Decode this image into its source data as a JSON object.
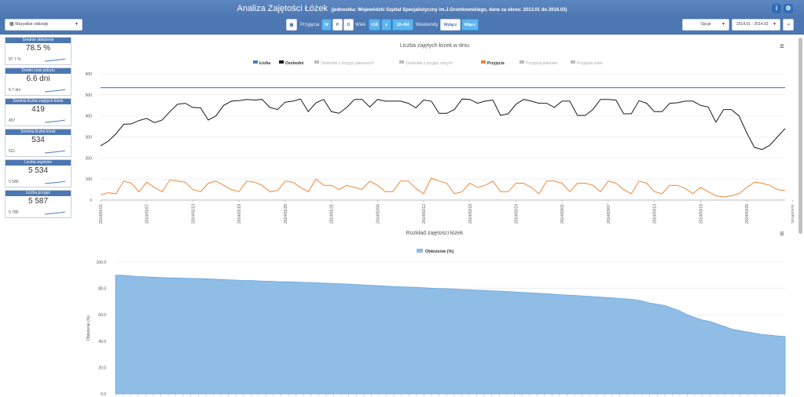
{
  "header": {
    "title": "Analiza Zajętości Łóżek",
    "subtitle": "(jednostka: Wojewódzki Szpital Specjalistyczny im.J.Gromkowskiego, dane za okres: 2013.01 do 2016.03)",
    "info_icon": "info-icon",
    "gear_icon": "gear-icon"
  },
  "toolbar": {
    "unit_select": "Wszystkie oddziały",
    "przyjecia_label": "Przyjęcia",
    "przyjecia_buttons": [
      "W",
      "P",
      "D"
    ],
    "wiek_label": "Wiek",
    "wiek_buttons": [
      "<18",
      "≥",
      "18-<64"
    ],
    "weekendy_label": "Weekendy",
    "weekendy_buttons": [
      "Wyłącz",
      "Włącz"
    ],
    "opcje": "Opcje",
    "date_range": "2014.01 - 2014.03"
  },
  "stats": [
    {
      "title": "Średnie obłożenie",
      "value": "78.5 %",
      "sub": "87.7 %"
    },
    {
      "title": "Średni czas pobytu",
      "value": "6.6 dni",
      "sub": "6.7 dni"
    },
    {
      "title": "Średnia liczba zajętych łóżek",
      "value": "419",
      "sub": "457"
    },
    {
      "title": "Średnia liczba łóżek",
      "value": "534",
      "sub": "521"
    },
    {
      "title": "Liczba wypisów",
      "value": "5 534",
      "sub": "5 580"
    },
    {
      "title": "Liczba przyjęć",
      "value": "5 587",
      "sub": "5 785"
    }
  ],
  "chart_data": [
    {
      "type": "line",
      "title": "Liczba zajętych łóżek w dniu",
      "legend": [
        "Łóżka",
        "Osobodni",
        "Osobodni z przyjęć planowych",
        "Osobodni z przyjęć ostrych",
        "Przyjęcia",
        "Przyjęcia planowe",
        "Przyjęcia ostre"
      ],
      "legend_colors": [
        "#4a7fc1",
        "#1a1a1a",
        "#bbbbbb",
        "#bbbbbb",
        "#f0883a",
        "#bbbbbb",
        "#bbbbbb"
      ],
      "ylim": [
        0,
        600
      ],
      "yticks": [
        0,
        100,
        200,
        300,
        400,
        500,
        600
      ],
      "xticks": [
        "2014/01/01",
        "2014/01/07",
        "2014/01/13",
        "2014/01/19",
        "2014/01/25",
        "2014/01/31",
        "2014/02/06",
        "2014/02/12",
        "2014/02/18",
        "2014/02/24",
        "2014/03/01",
        "2014/03/07",
        "2014/03/13",
        "2014/03/19",
        "2014/03/25",
        "2014/03/31"
      ],
      "series": [
        {
          "name": "Łóżka",
          "color": "#4a7fc1",
          "values": [
            534,
            534,
            534,
            534,
            534,
            534,
            534,
            534,
            534,
            534,
            534,
            534,
            534,
            534,
            534,
            534,
            534,
            534,
            534,
            534,
            534,
            534,
            534,
            534,
            534,
            534,
            534,
            534,
            534,
            534,
            534,
            534,
            534,
            534,
            534,
            534,
            534,
            534,
            534,
            534,
            534,
            534,
            534,
            534,
            534,
            534,
            534,
            534,
            534,
            534,
            534,
            534,
            534,
            534,
            534,
            534,
            534,
            534,
            534,
            534,
            534,
            534,
            534,
            534,
            534,
            534,
            534,
            534,
            534,
            534,
            534,
            534,
            534,
            534,
            534,
            534,
            534,
            534,
            534,
            534,
            534,
            534,
            534,
            534,
            534,
            534,
            534,
            534,
            534,
            534
          ]
        },
        {
          "name": "Osobodni",
          "color": "#1a1a1a",
          "values": [
            258,
            280,
            315,
            360,
            362,
            378,
            388,
            368,
            380,
            420,
            455,
            460,
            440,
            438,
            380,
            400,
            450,
            470,
            472,
            478,
            475,
            478,
            440,
            430,
            465,
            470,
            480,
            420,
            462,
            478,
            420,
            412,
            440,
            478,
            478,
            442,
            478,
            470,
            470,
            470,
            460,
            438,
            475,
            470,
            412,
            412,
            430,
            480,
            478,
            460,
            470,
            475,
            402,
            410,
            455,
            478,
            470,
            460,
            460,
            440,
            470,
            470,
            402,
            402,
            430,
            478,
            478,
            475,
            410,
            410,
            472,
            460,
            420,
            420,
            460,
            462,
            470,
            470,
            450,
            442,
            370,
            430,
            430,
            400,
            320,
            250,
            240,
            260,
            300,
            340
          ]
        },
        {
          "name": "Przyjęcia",
          "color": "#f0883a",
          "values": [
            25,
            35,
            30,
            90,
            80,
            40,
            85,
            60,
            40,
            95,
            90,
            85,
            50,
            40,
            80,
            90,
            70,
            50,
            40,
            90,
            85,
            70,
            40,
            45,
            90,
            85,
            60,
            40,
            100,
            70,
            70,
            50,
            70,
            60,
            50,
            90,
            70,
            40,
            40,
            90,
            90,
            55,
            30,
            105,
            90,
            80,
            30,
            40,
            80,
            60,
            70,
            90,
            40,
            40,
            80,
            80,
            60,
            30,
            90,
            90,
            80,
            40,
            80,
            80,
            70,
            40,
            90,
            80,
            50,
            30,
            90,
            80,
            40,
            30,
            70,
            70,
            55,
            30,
            60,
            40,
            20,
            15,
            20,
            30,
            60,
            85,
            80,
            70,
            50,
            45
          ]
        }
      ]
    },
    {
      "type": "area",
      "title": "Rozkład zajętości łóżek",
      "legend": [
        "Obłożenie (%)"
      ],
      "ylabel": "Obłożenie (%)",
      "ylim": [
        0,
        100
      ],
      "yticks": [
        "0.0",
        "20.0",
        "40.0",
        "60.0",
        "80.0",
        "100.0"
      ],
      "series": [
        {
          "name": "Obłożenie (%)",
          "color": "#8fbde6",
          "values": [
            90,
            90,
            89.5,
            89,
            88.8,
            88.5,
            88.3,
            88,
            88,
            87.8,
            87.6,
            87.5,
            87.3,
            87,
            86.8,
            86.5,
            86.3,
            86,
            86,
            85.7,
            85.5,
            85.3,
            85,
            85,
            84.8,
            84.6,
            84.4,
            84.2,
            84,
            83.7,
            83.5,
            83.2,
            83,
            82.7,
            82.3,
            82,
            81.7,
            81.5,
            81.2,
            81,
            80.8,
            80.5,
            80.2,
            80,
            79.8,
            79.5,
            79.2,
            79,
            78.7,
            78.5,
            78.2,
            78,
            77.7,
            77.4,
            77,
            76.7,
            76.4,
            76,
            75.7,
            75.3,
            75,
            74.7,
            74.3,
            74,
            73.6,
            73.2,
            72.8,
            72.4,
            72,
            71.5,
            70.5,
            69,
            68,
            67,
            65,
            63,
            60,
            58,
            56,
            55,
            53,
            51,
            49,
            48,
            47,
            46,
            45,
            44.5,
            44,
            43.5
          ]
        }
      ]
    }
  ]
}
